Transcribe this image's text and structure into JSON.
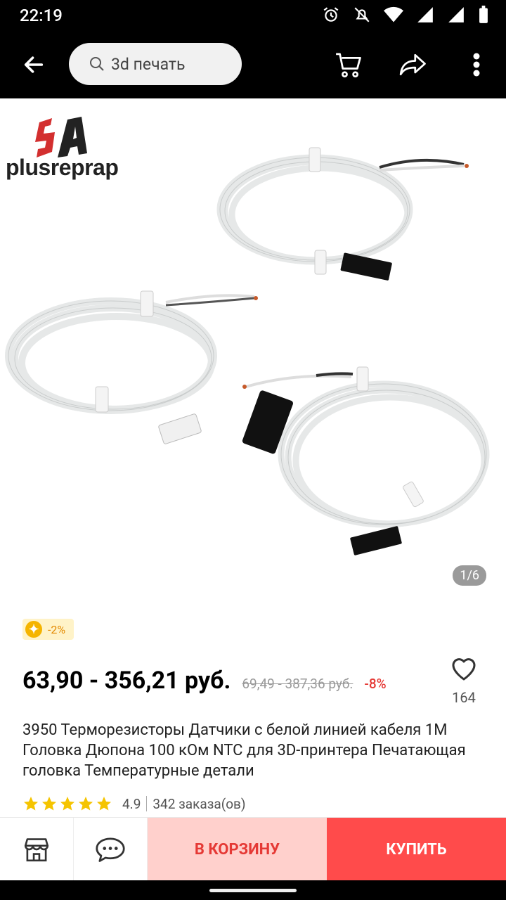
{
  "status_bar": {
    "time": "22:19"
  },
  "search": {
    "query": "3d печать"
  },
  "gallery": {
    "brand": "plusreprap",
    "page_indicator": "1/6"
  },
  "coupon": {
    "label": "-2%"
  },
  "price": {
    "current": "63,90 - 356,21 руб.",
    "old": "69,49 - 387,36 руб.",
    "discount": "-8%"
  },
  "wishlist": {
    "count": "164"
  },
  "product": {
    "title": "3950 Терморезисторы Датчики с белой линией кабеля 1М Головка Дюпона 100 кОм NTC для 3D-принтера Печатающая головка Температурные детали",
    "rating": "4.9",
    "orders": "342 заказа(ов)"
  },
  "actions": {
    "add_to_cart": "В КОРЗИНУ",
    "buy_now": "КУПИТЬ"
  },
  "colors": {
    "accent": "#ff4b4b",
    "cart_bg": "#ffd0cc",
    "star": "#f5c400"
  }
}
